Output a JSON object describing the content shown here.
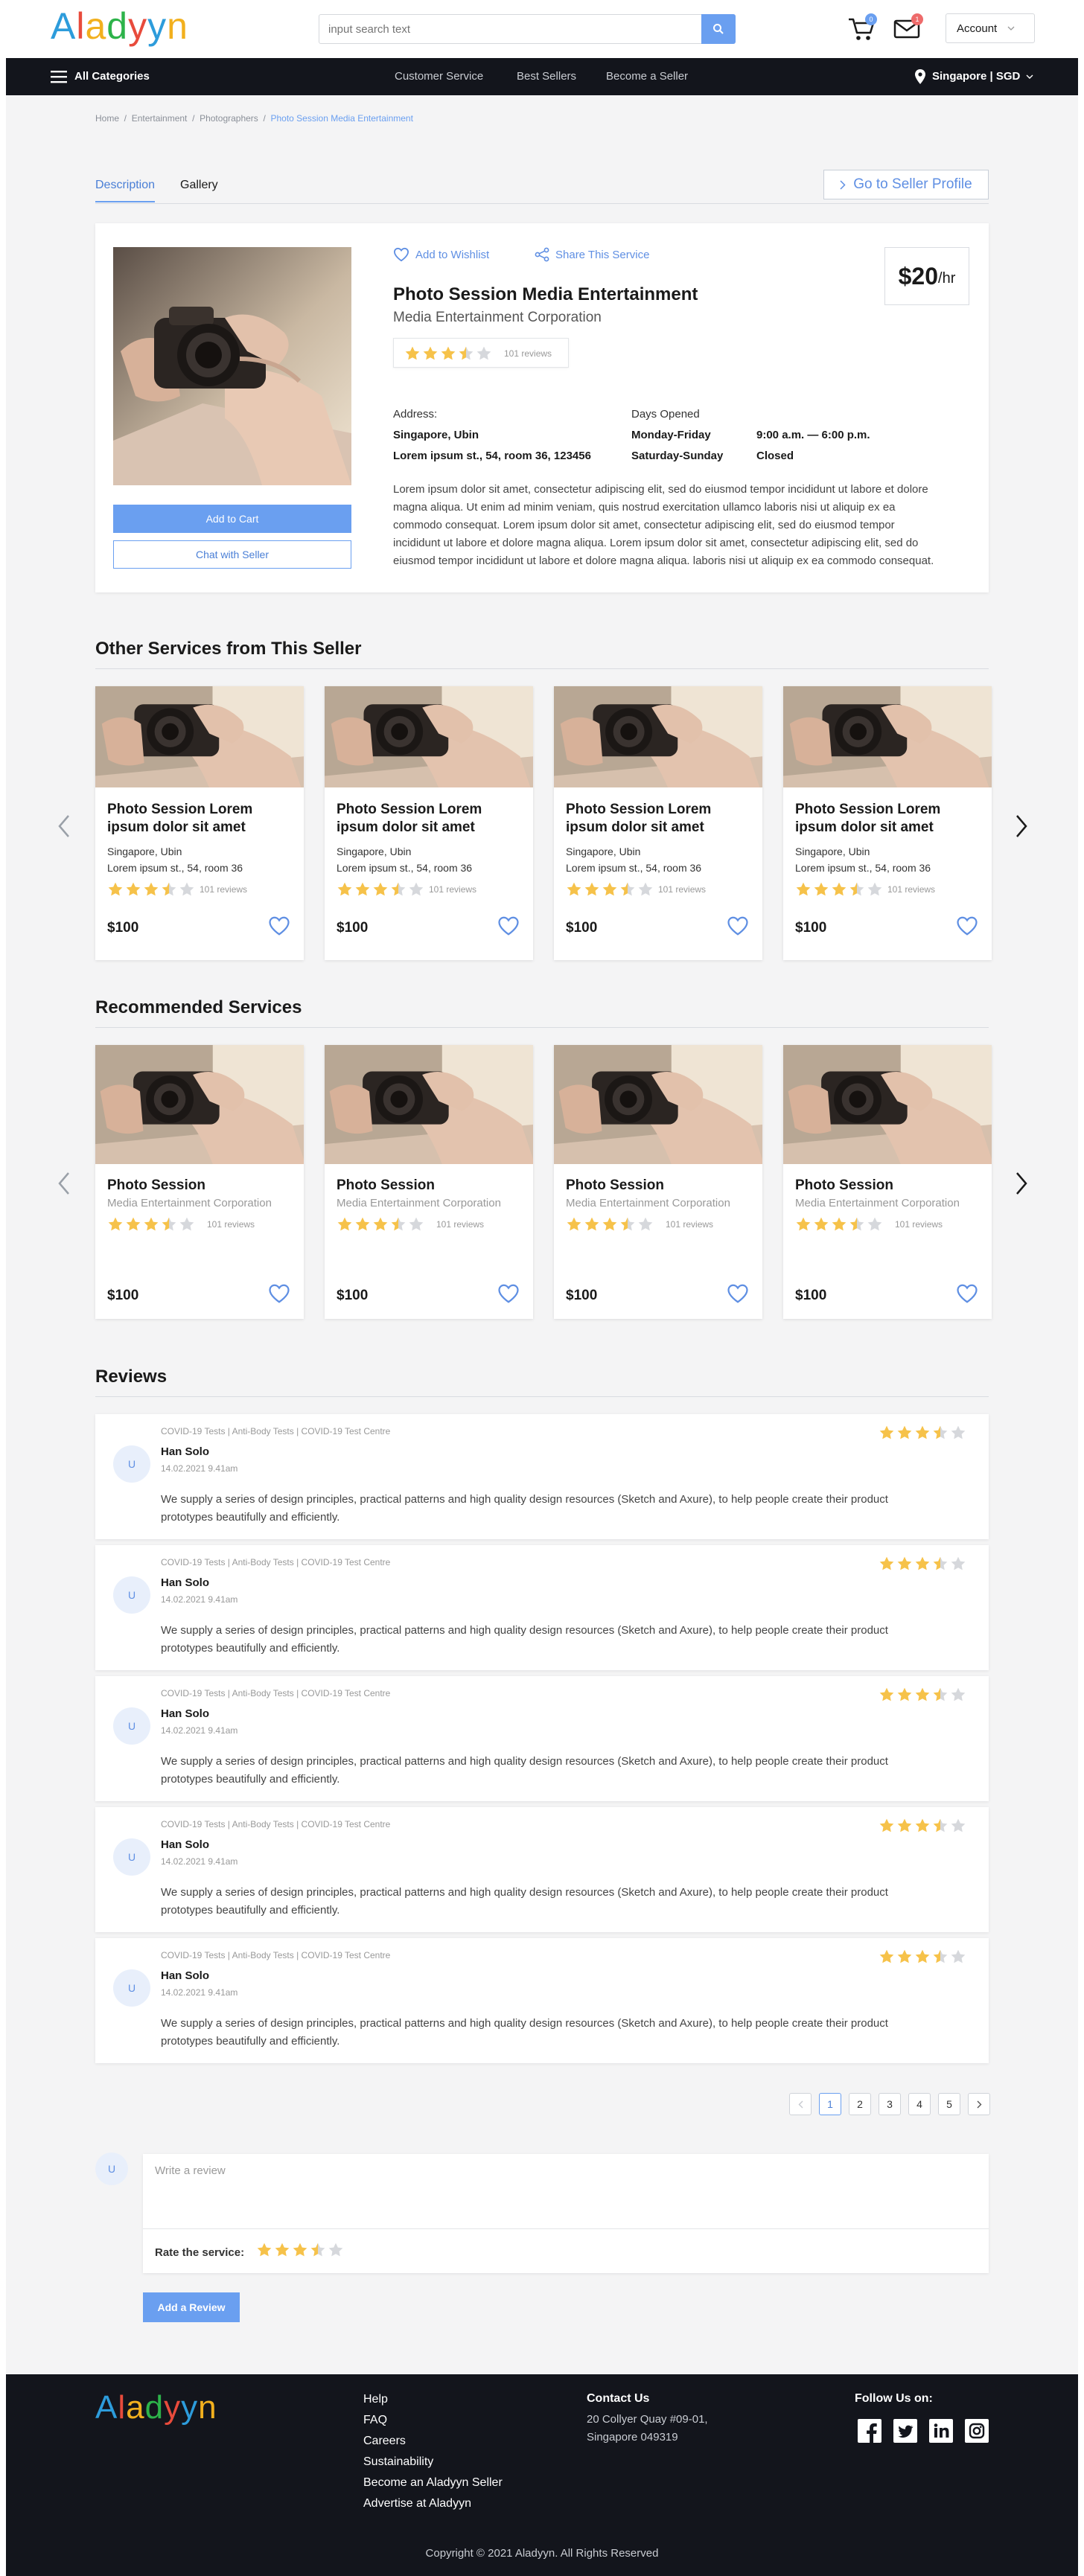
{
  "header": {
    "logo": "Aladyyn",
    "search_placeholder": "input search text",
    "cart_count": "0",
    "mail_count": "1",
    "account_label": "Account"
  },
  "nav": {
    "categories": "All Categories",
    "links": [
      "Customer Service",
      "Best Sellers",
      "Become a Seller"
    ],
    "region": "Singapore | SGD"
  },
  "breadcrumb": [
    "Home",
    "Entertainment",
    "Photographers",
    "Photo Session Media Entertainment"
  ],
  "tabs": [
    "Description",
    "Gallery"
  ],
  "seller_profile_button": "Go to Seller Profile",
  "product": {
    "wishlist": "Add to Wishlist",
    "share": "Share This Service",
    "price": "$20",
    "price_unit": "/hr",
    "title": "Photo Session Media Entertainment",
    "company": "Media Entertainment Corporation",
    "rating": 3.5,
    "reviews": "101 reviews",
    "address_label": "Address:",
    "address_city": "Singapore, Ubin",
    "address_street": "Lorem ipsum st., 54, room 36, 123456",
    "days_label": "Days Opened",
    "days": [
      {
        "day": "Monday-Friday",
        "hours": "9:00 a.m. — 6:00 p.m."
      },
      {
        "day": "Saturday-Sunday",
        "hours": "Closed"
      }
    ],
    "description_lines": [
      "Lorem ipsum dolor sit amet, consectetur adipiscing elit, sed do eiusmod tempor incididunt ut labore et dolore",
      "magna aliqua. Ut enim ad minim veniam, quis nostrud exercitation ullamco laboris nisi ut aliquip ex ea",
      "commodo consequat. Lorem ipsum dolor sit amet, consectetur adipiscing elit, sed do eiusmod tempor",
      "incididunt ut labore et dolore magna aliqua.  Lorem ipsum dolor sit amet, consectetur adipiscing elit, sed do",
      "eiusmod tempor incididunt ut labore et dolore magna aliqua. laboris nisi ut aliquip ex ea commodo consequat."
    ],
    "add_to_cart": "Add to Cart",
    "chat": "Chat with Seller"
  },
  "other_services": {
    "heading": "Other Services from This Seller",
    "items": [
      {
        "title": "Photo Session Lorem ipsum dolor sit amet",
        "city": "Singapore, Ubin",
        "street": "Lorem ipsum st., 54, room 36",
        "rating": 3.5,
        "reviews": "101 reviews",
        "price": "$100"
      },
      {
        "title": "Photo Session Lorem ipsum dolor sit amet",
        "city": "Singapore, Ubin",
        "street": "Lorem ipsum st., 54, room 36",
        "rating": 3.5,
        "reviews": "101 reviews",
        "price": "$100"
      },
      {
        "title": "Photo Session Lorem ipsum dolor sit amet",
        "city": "Singapore, Ubin",
        "street": "Lorem ipsum st., 54, room 36",
        "rating": 3.5,
        "reviews": "101 reviews",
        "price": "$100"
      },
      {
        "title": "Photo Session Lorem ipsum dolor sit amet",
        "city": "Singapore, Ubin",
        "street": "Lorem ipsum st., 54, room 36",
        "rating": 3.5,
        "reviews": "101 reviews",
        "price": "$100"
      }
    ]
  },
  "recommended": {
    "heading": "Recommended Services",
    "items": [
      {
        "title": "Photo Session",
        "company": "Media Entertainment Corporation",
        "rating": 3.5,
        "reviews": "101 reviews",
        "price": "$100"
      },
      {
        "title": "Photo Session",
        "company": "Media Entertainment Corporation",
        "rating": 3.5,
        "reviews": "101 reviews",
        "price": "$100"
      },
      {
        "title": "Photo Session",
        "company": "Media Entertainment Corporation",
        "rating": 3.5,
        "reviews": "101 reviews",
        "price": "$100"
      },
      {
        "title": "Photo Session",
        "company": "Media Entertainment Corporation",
        "rating": 3.5,
        "reviews": "101 reviews",
        "price": "$100"
      }
    ]
  },
  "reviews": {
    "heading": "Reviews",
    "items": [
      {
        "avatar": "U",
        "tags": "COVID-19 Tests | Anti-Body Tests | COVID-19 Test Centre",
        "name": "Han Solo",
        "date": "14.02.2021 9.41am",
        "rating": 3.5,
        "text1": "We supply a series of design principles, practical patterns and high quality design resources (Sketch and Axure), to help people create their product",
        "text2": "prototypes beautifully and efficiently."
      },
      {
        "avatar": "U",
        "tags": "COVID-19 Tests | Anti-Body Tests | COVID-19 Test Centre",
        "name": "Han Solo",
        "date": "14.02.2021 9.41am",
        "rating": 3.5,
        "text1": "We supply a series of design principles, practical patterns and high quality design resources (Sketch and Axure), to help people create their product",
        "text2": "prototypes beautifully and efficiently."
      },
      {
        "avatar": "U",
        "tags": "COVID-19 Tests | Anti-Body Tests | COVID-19 Test Centre",
        "name": "Han Solo",
        "date": "14.02.2021 9.41am",
        "rating": 3.5,
        "text1": "We supply a series of design principles, practical patterns and high quality design resources (Sketch and Axure), to help people create their product",
        "text2": "prototypes beautifully and efficiently."
      },
      {
        "avatar": "U",
        "tags": "COVID-19 Tests | Anti-Body Tests | COVID-19 Test Centre",
        "name": "Han Solo",
        "date": "14.02.2021 9.41am",
        "rating": 3.5,
        "text1": "We supply a series of design principles, practical patterns and high quality design resources (Sketch and Axure), to help people create their product",
        "text2": "prototypes beautifully and efficiently."
      },
      {
        "avatar": "U",
        "tags": "COVID-19 Tests | Anti-Body Tests | COVID-19 Test Centre",
        "name": "Han Solo",
        "date": "14.02.2021 9.41am",
        "rating": 3.5,
        "text1": "We supply a series of design principles, practical patterns and high quality design resources (Sketch and Axure), to help people create their product",
        "text2": "prototypes beautifully and efficiently."
      }
    ]
  },
  "pagination": {
    "pages": [
      "1",
      "2",
      "3",
      "4",
      "5"
    ],
    "current": "1"
  },
  "write_review": {
    "avatar": "U",
    "placeholder": "Write a review",
    "rate_label": "Rate the service:",
    "rating": 3.5,
    "submit": "Add a Review"
  },
  "footer": {
    "logo": "Aladyyn",
    "links": [
      "Help",
      "FAQ",
      "Careers",
      "Sustainability",
      "Become an Aladyyn Seller",
      "Advertise at Aladyyn"
    ],
    "contact_title": "Contact Us",
    "contact_lines": [
      "20 Collyer Quay #09-01,",
      "Singapore 049319"
    ],
    "follow_title": "Follow Us on:",
    "social_icons": [
      "facebook-icon",
      "twitter-icon",
      "linkedin-icon",
      "instagram-icon"
    ],
    "copyright": "Copyright © 2021 Aladyyn. All Rights Reserved"
  },
  "colors": {
    "accent": "#6a9ff0",
    "star": "#f6c24a",
    "star_empty": "#d6d8dc",
    "nav": "#13151c"
  }
}
